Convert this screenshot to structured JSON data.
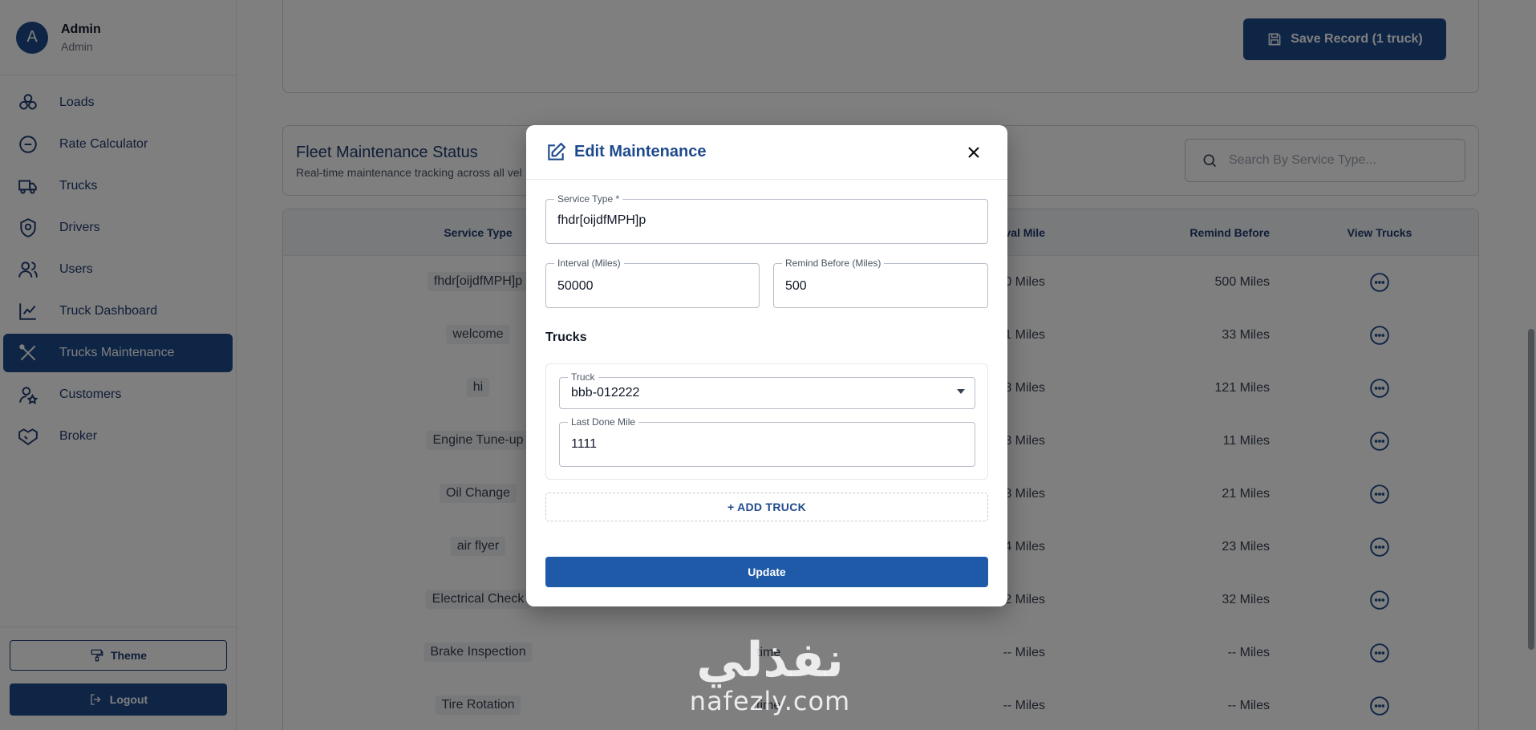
{
  "profile": {
    "initial": "A",
    "name": "Admin",
    "role": "Admin"
  },
  "nav": [
    {
      "label": "Loads",
      "icon": "loads-icon"
    },
    {
      "label": "Rate Calculator",
      "icon": "calculator-icon"
    },
    {
      "label": "Trucks",
      "icon": "truck-icon"
    },
    {
      "label": "Drivers",
      "icon": "shield-icon"
    },
    {
      "label": "Users",
      "icon": "users-icon"
    },
    {
      "label": "Truck Dashboard",
      "icon": "chart-icon"
    },
    {
      "label": "Trucks Maintenance",
      "icon": "tools-icon",
      "active": true
    },
    {
      "label": "Customers",
      "icon": "customers-icon"
    },
    {
      "label": "Broker",
      "icon": "handshake-icon"
    }
  ],
  "sidebar_footer": {
    "theme_label": "Theme",
    "logout_label": "Logout"
  },
  "top_card": {
    "save_label": "Save Record (1 truck)"
  },
  "status": {
    "title": "Fleet Maintenance Status",
    "subtitle": "Real-time maintenance tracking across all vel",
    "search_placeholder": "Search By Service Type..."
  },
  "table": {
    "columns": {
      "service": "Service Type",
      "interval": "val Mile",
      "remind": "Remind Before",
      "view": "View Trucks"
    },
    "rows": [
      {
        "service": "fhdr[oijdfMPH]p",
        "description": "",
        "interval": "0 Miles",
        "remind": "500 Miles"
      },
      {
        "service": "welcome",
        "description": "",
        "interval": "1 Miles",
        "remind": "33 Miles"
      },
      {
        "service": "hi",
        "description": "",
        "interval": "3 Miles",
        "remind": "121 Miles"
      },
      {
        "service": "Engine Tune-up",
        "description": "",
        "interval": "3 Miles",
        "remind": "11 Miles"
      },
      {
        "service": "Oil Change",
        "description": "",
        "interval": "3 Miles",
        "remind": "21 Miles"
      },
      {
        "service": "air flyer",
        "description": "",
        "interval": "4 Miles",
        "remind": "23 Miles"
      },
      {
        "service": "Electrical Check",
        "description": "",
        "interval": "2 Miles",
        "remind": "32 Miles"
      },
      {
        "service": "Brake Inspection",
        "description": "time",
        "interval": "-- Miles",
        "remind": "-- Miles"
      },
      {
        "service": "Tire Rotation",
        "description": "time",
        "interval": "-- Miles",
        "remind": "-- Miles"
      }
    ]
  },
  "modal": {
    "title": "Edit Maintenance",
    "service_type": {
      "label": "Service Type *",
      "value": "fhdr[oijdfMPH]p"
    },
    "interval": {
      "label": "Interval (Miles)",
      "value": "50000"
    },
    "remind_before": {
      "label": "Remind Before (Miles)",
      "value": "500"
    },
    "trucks_heading": "Trucks",
    "truck": {
      "label": "Truck",
      "value": "bbb-012222"
    },
    "last_done": {
      "label": "Last Done Mile",
      "value": "1111"
    },
    "add_truck_label": "+ ADD TRUCK",
    "update_label": "Update"
  },
  "watermark": {
    "arabic": "نفذلي",
    "latin": "nafezly.com"
  }
}
